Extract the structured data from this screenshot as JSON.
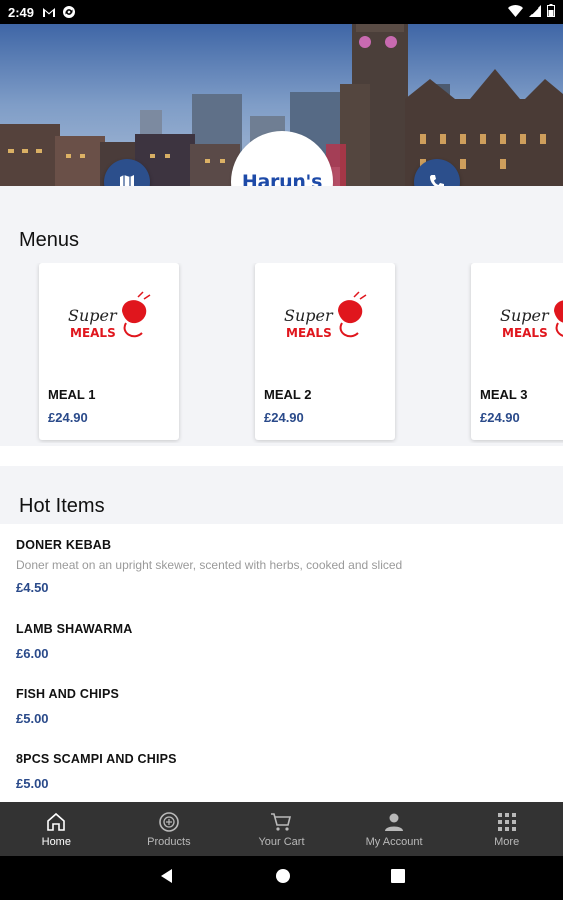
{
  "status_bar": {
    "time": "2:49",
    "left_icons": [
      "gmail-m-icon",
      "sync-icon"
    ],
    "right_icons": [
      "wifi-icon",
      "signal-icon",
      "battery-icon"
    ]
  },
  "header": {
    "brand_logo_text": "Harun's",
    "map_button": "map-icon",
    "call_button": "phone-icon"
  },
  "menus": {
    "title": "Menus",
    "logo_text_top": "Super",
    "logo_text_bottom": "MEALS",
    "items": [
      {
        "name": "MEAL 1",
        "price": "£24.90"
      },
      {
        "name": "MEAL 2",
        "price": "£24.90"
      },
      {
        "name": "MEAL 3",
        "price": "£24.90"
      }
    ]
  },
  "hot_items": {
    "title": "Hot Items",
    "items": [
      {
        "name": "DONER KEBAB",
        "description": "Doner meat on an upright skewer, scented with herbs, cooked and sliced",
        "price": "£4.50"
      },
      {
        "name": "LAMB SHAWARMA",
        "description": "",
        "price": "£6.00"
      },
      {
        "name": "FISH AND CHIPS",
        "description": "",
        "price": "£5.00"
      },
      {
        "name": "8PCS SCAMPI AND CHIPS",
        "description": "",
        "price": "£5.00"
      }
    ]
  },
  "bottom_nav": {
    "items": [
      {
        "label": "Home",
        "icon": "home-icon",
        "active": true
      },
      {
        "label": "Products",
        "icon": "products-icon",
        "active": false
      },
      {
        "label": "Your Cart",
        "icon": "cart-icon",
        "active": false
      },
      {
        "label": "My Account",
        "icon": "account-icon",
        "active": false
      },
      {
        "label": "More",
        "icon": "grid-icon",
        "active": false
      }
    ]
  },
  "colors": {
    "accent": "#2c4f8c",
    "price": "#2a4a8a",
    "nav_bg": "#333333",
    "section_bg": "#f3f4f7",
    "logo_red": "#e0161d"
  }
}
